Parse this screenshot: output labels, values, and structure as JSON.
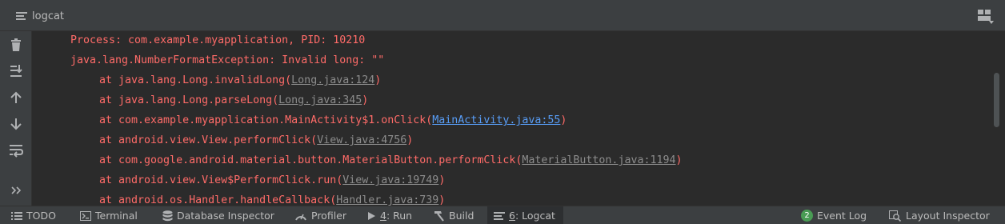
{
  "header": {
    "title": "logcat"
  },
  "toolbar": {
    "items": [
      "trash-icon",
      "scroll-to-end-icon",
      "up-arrow-icon",
      "down-arrow-icon",
      "soft-wrap-icon",
      "more-chevron-icon"
    ]
  },
  "log": {
    "lines": [
      {
        "text": "Process: com.example.myapplication, PID: 10210"
      },
      {
        "text": "java.lang.NumberFormatException: Invalid long: \"\""
      },
      {
        "prefix": "at java.lang.Long.invalidLong(",
        "link": "Long.java:124",
        "suffix": ")"
      },
      {
        "prefix": "at java.lang.Long.parseLong(",
        "link": "Long.java:345",
        "suffix": ")"
      },
      {
        "prefix": "at com.example.myapplication.MainActivity$1.onClick(",
        "link": "MainActivity.java:55",
        "suffix": ")"
      },
      {
        "prefix": "at android.view.View.performClick(",
        "link": "View.java:4756",
        "suffix": ")"
      },
      {
        "prefix": "at com.google.android.material.button.MaterialButton.performClick(",
        "link": "MaterialButton.java:1194",
        "suffix": ")"
      },
      {
        "prefix": "at android.view.View$PerformClick.run(",
        "link": "View.java:19749",
        "suffix": ")"
      },
      {
        "prefix": "at android.os.Handler.handleCallback(",
        "link": "Handler.java:739",
        "suffix": ")"
      }
    ]
  },
  "bottom": {
    "todo": "TODO",
    "terminal": "Terminal",
    "database": "Database Inspector",
    "profiler": "Profiler",
    "run_num": "4",
    "run": ": Run",
    "build": "Build",
    "logcat_num": "6",
    "logcat": ": Logcat",
    "event_count": "2",
    "event_log": "Event Log",
    "layout_inspector": "Layout Inspector"
  },
  "colors": {
    "error_text": "#ff6b68",
    "link": "#8c8c8c",
    "link_highlight": "#589df6",
    "panel": "#3c3f41",
    "editor": "#2b2b2b",
    "badge": "#499c54"
  }
}
